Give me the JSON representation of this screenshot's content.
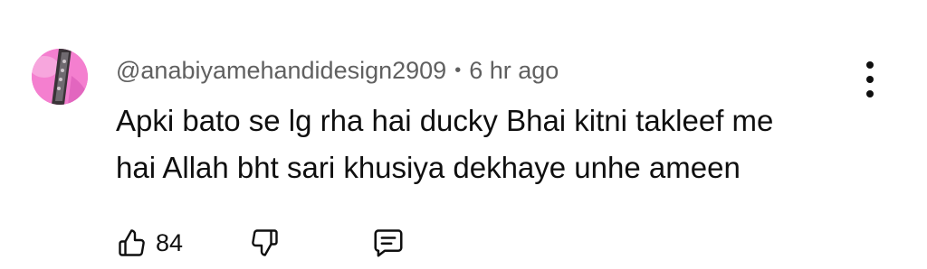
{
  "comment": {
    "username": "@anabiyamehandidesign2909",
    "separator": "•",
    "time": "6 hr ago",
    "text_lines": [
      "Apki bato se lg rha hai ducky Bhai kitni takleef me",
      "hai Allah bht sari khusiya dekhaye unhe ameen"
    ],
    "like_count": "84"
  },
  "icons": {
    "like": "thumb-up-icon",
    "dislike": "thumb-down-icon",
    "reply": "reply-comment-icon",
    "more": "more-vertical-icon"
  },
  "colors": {
    "text": "#0f0f0f",
    "meta": "#606060",
    "avatar_bg": "#f47fcf"
  }
}
